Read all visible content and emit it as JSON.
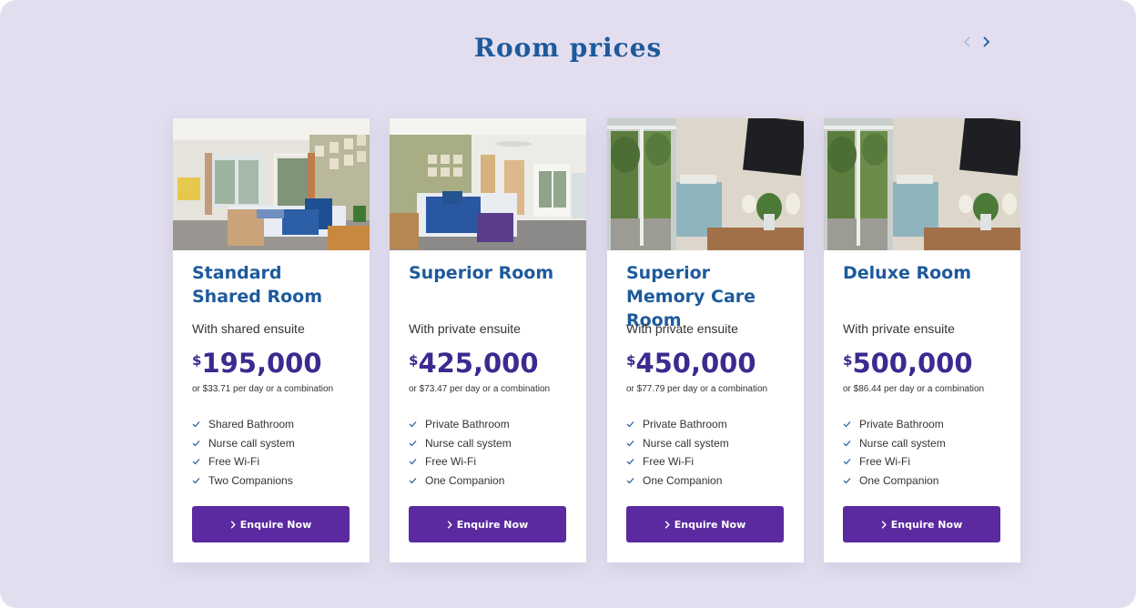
{
  "section": {
    "title": "Room prices",
    "prev_icon": "chevron-left-icon",
    "next_icon": "chevron-right-icon"
  },
  "colors": {
    "background": "#e2deef",
    "title": "#1d5a9c",
    "price": "#3d2990",
    "button": "#5b2aa0",
    "check": "#1d5a9c"
  },
  "cards": [
    {
      "title": "Standard Shared Room",
      "subtitle": "With shared ensuite",
      "currency": "$",
      "price": "195,000",
      "note": "or $33.71 per day or a combination",
      "features": [
        "Shared Bathroom",
        "Nurse call system",
        "Free Wi-Fi",
        "Two Companions"
      ],
      "button_label": "Enquire Now"
    },
    {
      "title": "Superior Room",
      "subtitle": "With private ensuite",
      "currency": "$",
      "price": "425,000",
      "note": "or $73.47 per day or a combination",
      "features": [
        "Private Bathroom",
        "Nurse call system",
        "Free Wi-Fi",
        "One Companion"
      ],
      "button_label": "Enquire Now"
    },
    {
      "title": "Superior Memory Care Room",
      "subtitle": "With private ensuite",
      "currency": "$",
      "price": "450,000",
      "note": "or $77.79 per day or a combination",
      "features": [
        "Private Bathroom",
        "Nurse call system",
        "Free Wi-Fi",
        "One Companion"
      ],
      "button_label": "Enquire Now"
    },
    {
      "title": "Deluxe Room",
      "subtitle": "With private ensuite",
      "currency": "$",
      "price": "500,000",
      "note": "or $86.44 per day or a combination",
      "features": [
        "Private Bathroom",
        "Nurse call system",
        "Free Wi-Fi",
        "One Companion"
      ],
      "button_label": "Enquire Now"
    }
  ]
}
